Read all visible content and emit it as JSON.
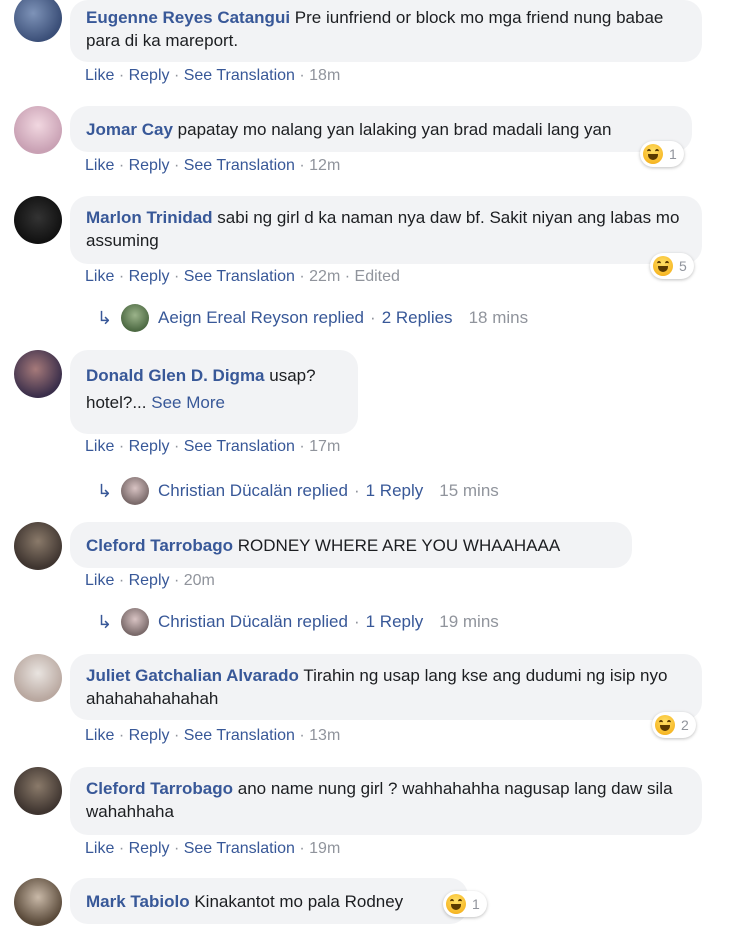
{
  "ui": {
    "like": "Like",
    "reply": "Reply",
    "see_translation": "See Translation",
    "dot": "·",
    "see_more": "See More"
  },
  "comments": [
    {
      "author": "Eugenne Reyes Catangui",
      "text": "Pre iunfriend or block mo mga friend nung babae para di ka mareport.",
      "time": "18m"
    },
    {
      "author": "Jomar Cay",
      "text": "papatay mo nalang yan lalaking yan brad madali lang yan",
      "time": "12m",
      "reaction": {
        "icon": "haha-icon",
        "count": "1"
      }
    },
    {
      "author": "Marlon Trinidad",
      "text": "sabi ng girl d ka naman nya daw bf. Sakit niyan ang labas mo assuming",
      "time": "22m",
      "edited": "Edited",
      "reaction": {
        "icon": "haha-icon",
        "count": "5"
      },
      "replies": {
        "who": "Aeign Ereal Reyson replied",
        "count": "2 Replies",
        "time": "18 mins"
      }
    },
    {
      "author": "Donald Glen D. Digma",
      "text": "usap?",
      "text2": "hotel?...",
      "time": "17m",
      "replies": {
        "who": "Christian Dücalän replied",
        "count": "1 Reply",
        "time": "15 mins"
      }
    },
    {
      "author": "Cleford Tarrobago",
      "text": "RODNEY WHERE ARE YOU WHAAHAAA",
      "time": "20m",
      "replies": {
        "who": "Christian Dücalän replied",
        "count": "1 Reply",
        "time": "19 mins"
      }
    },
    {
      "author": "Juliet Gatchalian Alvarado",
      "text": "Tirahin ng usap lang kse ang dudumi ng isip nyo ahahahahahahah",
      "time": "13m",
      "reaction": {
        "icon": "haha-icon",
        "count": "2"
      }
    },
    {
      "author": "Cleford Tarrobago",
      "text": "ano name nung girl ? wahhahahha nagusap lang daw sila wahahhaha",
      "time": "19m"
    },
    {
      "author": "Mark Tabiolo",
      "text": "Kinakantot mo pala Rodney",
      "reaction": {
        "icon": "haha-icon",
        "count": "1"
      }
    }
  ],
  "colors": {
    "link": "#385898",
    "meta": "#90949c",
    "bubble": "#f2f3f5"
  }
}
